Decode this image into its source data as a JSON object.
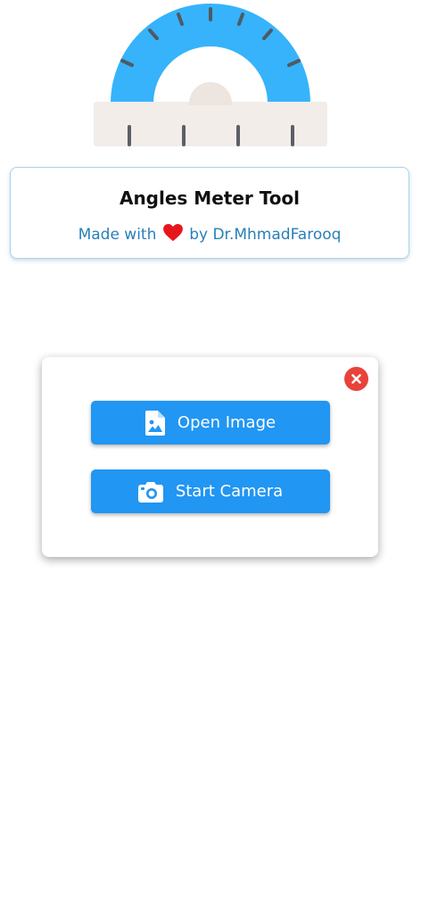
{
  "header": {
    "title": "Angles Meter Tool",
    "credit_prefix": "Made with",
    "credit_suffix": "by Dr.MhmadFarooq",
    "heart_icon": "heart-icon",
    "heart_color": "#e8161c"
  },
  "logo": {
    "icon": "protractor-icon",
    "arc_color": "#36b3fb",
    "base_color": "#f2ede9"
  },
  "dialog": {
    "close_icon": "close-icon",
    "close_color": "#e8433a",
    "buttons": [
      {
        "label": "Open Image",
        "icon": "image-file-icon"
      },
      {
        "label": "Start Camera",
        "icon": "camera-icon"
      }
    ],
    "button_color": "#2196f3"
  }
}
